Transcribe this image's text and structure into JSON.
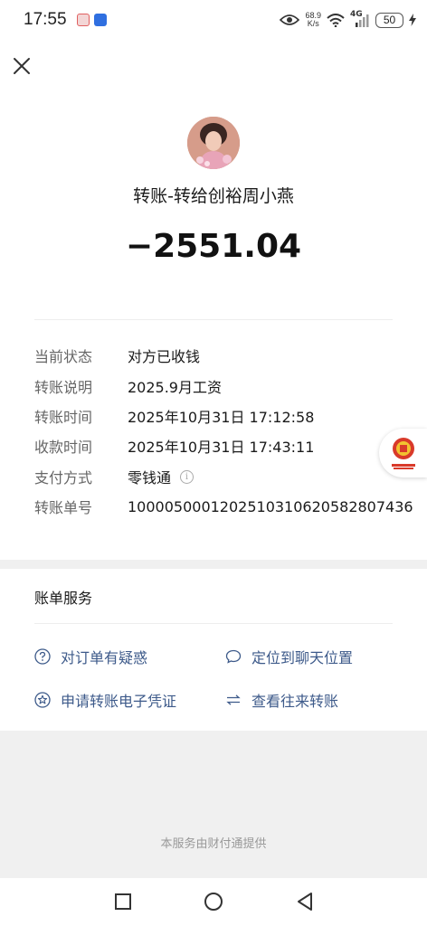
{
  "status_bar": {
    "time": "17:55",
    "net_speed_value": "68.9",
    "net_speed_unit": "K/s",
    "net_type": "4G",
    "battery": "50"
  },
  "transfer": {
    "title": "转账-转给创裕周小燕",
    "amount": "−2551.04"
  },
  "details": [
    {
      "label": "当前状态",
      "value": "对方已收钱"
    },
    {
      "label": "转账说明",
      "value": "2025.9月工资"
    },
    {
      "label": "转账时间",
      "value": "2025年10月31日 17:12:58"
    },
    {
      "label": "收款时间",
      "value": "2025年10月31日 17:43:11"
    },
    {
      "label": "支付方式",
      "value": "零钱通"
    },
    {
      "label": "转账单号",
      "value": "1000050001202510310620582807436"
    }
  ],
  "services": {
    "title": "账单服务",
    "links": [
      {
        "label": "对订单有疑惑",
        "icon": "question-circle-icon"
      },
      {
        "label": "定位到聊天位置",
        "icon": "chat-bubble-icon"
      },
      {
        "label": "申请转账电子凭证",
        "icon": "star-circle-icon"
      },
      {
        "label": "查看往来转账",
        "icon": "exchange-arrows-icon"
      }
    ],
    "link_color": "#3d5a8a"
  },
  "footer": "本服务由财付通提供"
}
